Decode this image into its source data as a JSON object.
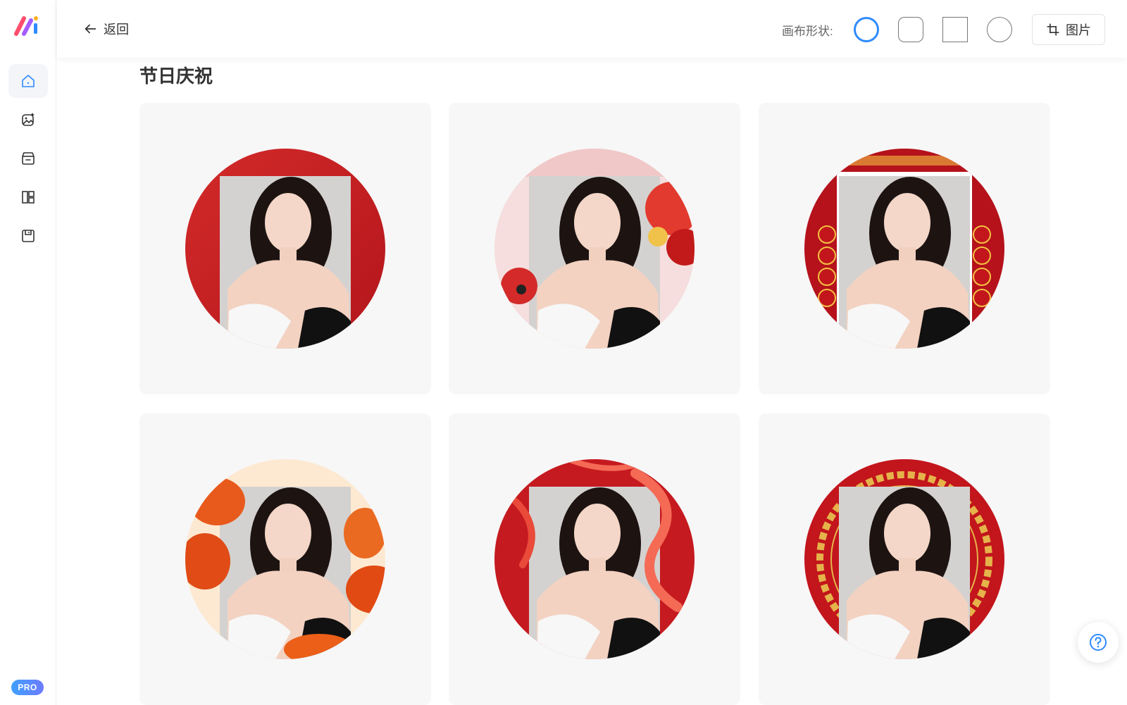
{
  "app": {
    "logo_icon": "ai-logo-icon",
    "badge": "PRO"
  },
  "sidebar": {
    "items": [
      {
        "icon": "home-icon",
        "active": true
      },
      {
        "icon": "image-edit-icon",
        "active": false
      },
      {
        "icon": "box-icon",
        "active": false
      },
      {
        "icon": "layout-icon",
        "active": false
      },
      {
        "icon": "save-icon",
        "active": false
      }
    ]
  },
  "toolbar": {
    "back_label": "返回",
    "shape_label": "画布形状:",
    "shapes": [
      "circle",
      "rounded-square",
      "square",
      "circle-outline"
    ],
    "selected_shape": "circle",
    "image_button_label": "图片"
  },
  "main": {
    "section_title": "节日庆祝",
    "templates": [
      {
        "name": "red-frame"
      },
      {
        "name": "lion-dance"
      },
      {
        "name": "greeting-couplets"
      },
      {
        "name": "lanterns"
      },
      {
        "name": "red-ribbons"
      },
      {
        "name": "golden-pattern"
      }
    ]
  },
  "colors": {
    "accent": "#2f8bff",
    "festive_red": "#c8151d"
  }
}
